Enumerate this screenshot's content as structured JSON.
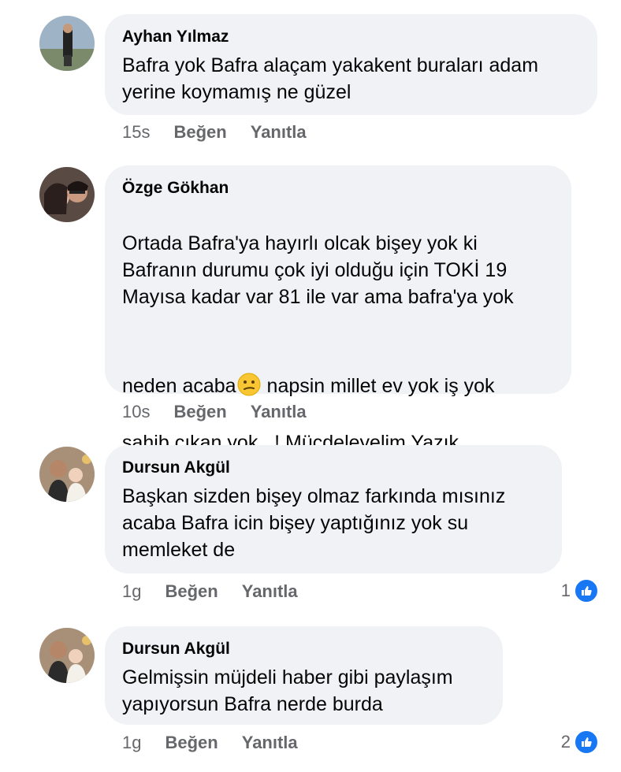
{
  "comments": [
    {
      "author": "Ayhan Yılmaz",
      "text": "Bafra yok Bafra alaçam yakakent buraları adam\nyerine koymamış ne güzel",
      "time": "15s",
      "like_label": "Beğen",
      "reply_label": "Yanıtla",
      "reactions": ""
    },
    {
      "author": "Özge Gökhan",
      "text_line1": "Ortada Bafra'ya hayırlı olcak bişey yok ki\nBafranın durumu çok iyi olduğu için TOKİ 19\nMayısa kadar var 81 ile var ama bafra'ya yok",
      "text_pre_emoji": "neden acaba",
      "emoji": "confused-face",
      "text_post_emoji": " napsin millet ev yok iş yok",
      "text_line2": "sahib çıkan yok...! Mücdeleyelim Yazık\nBafralılara",
      "time": "10s",
      "like_label": "Beğen",
      "reply_label": "Yanıtla",
      "reactions": ""
    },
    {
      "author": "Dursun Akgül",
      "text": "Başkan sizden bişey olmaz farkında mısınız\nacaba Bafra icin bişey yaptığınız yok su\nmemleket de",
      "time": "1g",
      "like_label": "Beğen",
      "reply_label": "Yanıtla",
      "reactions": "1"
    },
    {
      "author": "Dursun Akgül",
      "text": "Gelmişsin müjdeli haber gibi paylaşım\nyapıyorsun Bafra nerde burda",
      "time": "1g",
      "like_label": "Beğen",
      "reply_label": "Yanıtla",
      "reactions": "2"
    }
  ],
  "colors": {
    "bubble": "#f0f2f5",
    "meta_text": "#65676b",
    "like_blue": "#1877f2"
  },
  "icons": [
    "like-thumb-icon",
    "confused-face-emoji-icon"
  ]
}
